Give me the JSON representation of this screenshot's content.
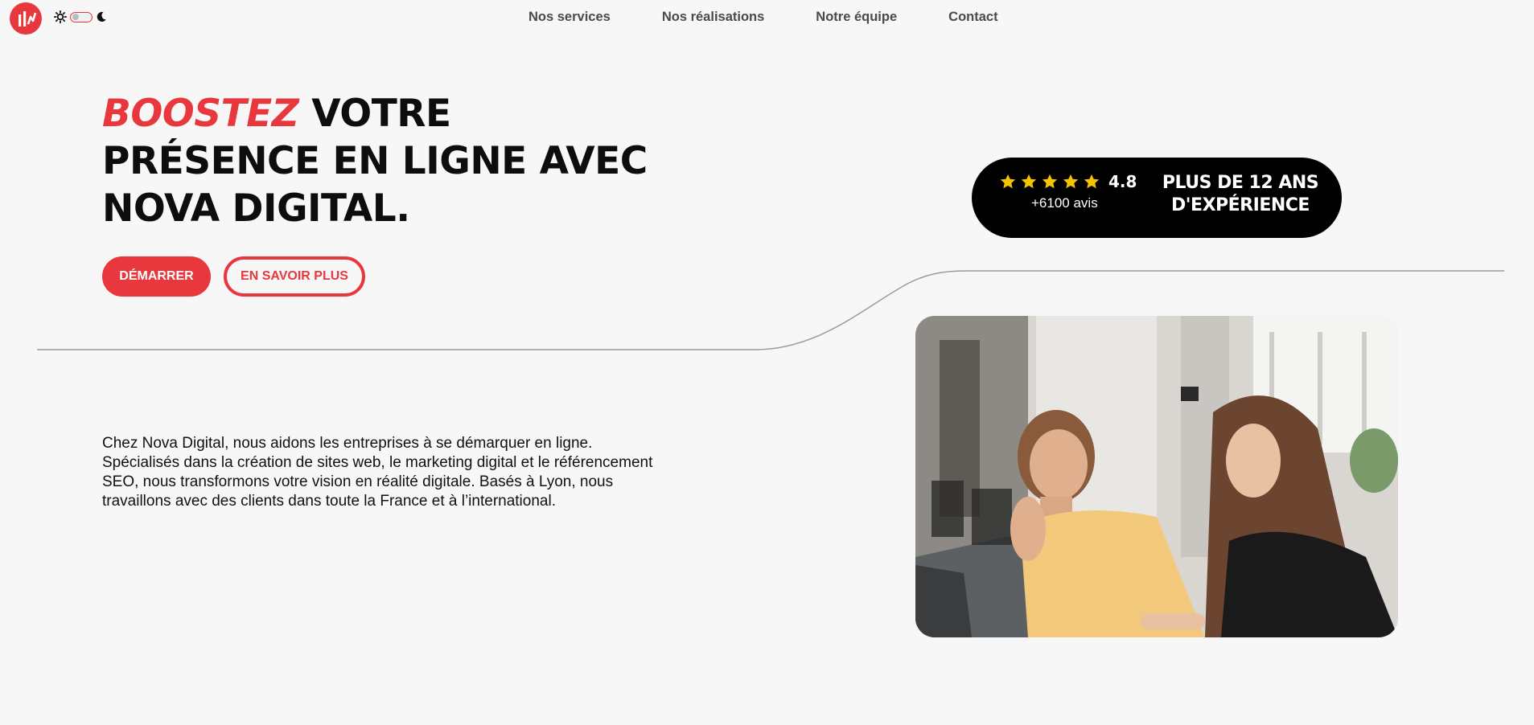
{
  "nav": {
    "items": [
      {
        "label": "Nos services"
      },
      {
        "label": "Nos réalisations"
      },
      {
        "label": "Notre équipe"
      },
      {
        "label": "Contact"
      }
    ]
  },
  "theme": {
    "light_icon": "sun-icon",
    "dark_icon": "moon-icon",
    "mode": "light"
  },
  "hero": {
    "title_accent": "BOOSTEZ",
    "title_rest": "VOTRE PRÉSENCE EN LIGNE AVEC NOVA DIGITAL.",
    "primary_button": "DÉMARRER",
    "secondary_button": "EN SAVOIR PLUS",
    "intro": "Chez Nova Digital, nous aidons les entreprises à se démarquer en ligne. Spécialisés dans la création de sites web, le marketing digital et le référencement SEO, nous transformons votre vision en réalité digitale. Basés à Lyon, nous travaillons avec des clients dans toute la France et à l’international."
  },
  "badge": {
    "rating": "4.8",
    "stars": 5,
    "reviews": "+6100 avis",
    "experience": "PLUS DE 12 ANS D'EXPÉRIENCE"
  },
  "colors": {
    "accent": "#e8383d",
    "star": "#f5c400",
    "background": "#f7f7f7"
  }
}
